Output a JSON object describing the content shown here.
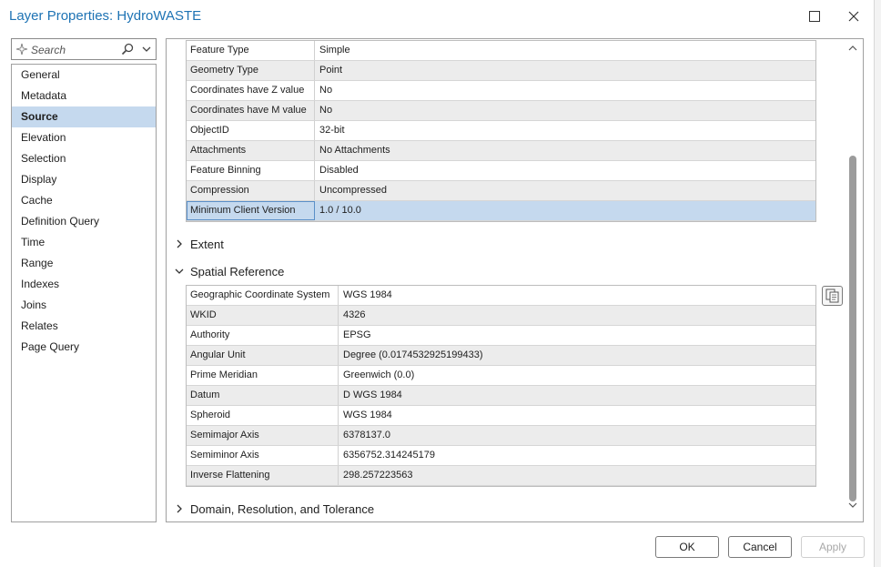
{
  "window": {
    "title": "Layer Properties: HydroWASTE"
  },
  "search": {
    "placeholder": "Search"
  },
  "nav": {
    "items": [
      "General",
      "Metadata",
      "Source",
      "Elevation",
      "Selection",
      "Display",
      "Cache",
      "Definition Query",
      "Time",
      "Range",
      "Indexes",
      "Joins",
      "Relates",
      "Page Query"
    ],
    "selected": "Source"
  },
  "source_table": {
    "rows": [
      {
        "key": "Feature Type",
        "value": "Simple"
      },
      {
        "key": "Geometry Type",
        "value": "Point"
      },
      {
        "key": "Coordinates have Z value",
        "value": "No"
      },
      {
        "key": "Coordinates have M value",
        "value": "No"
      },
      {
        "key": "ObjectID",
        "value": "32-bit"
      },
      {
        "key": "Attachments",
        "value": "No Attachments"
      },
      {
        "key": "Feature Binning",
        "value": "Disabled"
      },
      {
        "key": "Compression",
        "value": "Uncompressed"
      },
      {
        "key": "Minimum Client Version",
        "value": "1.0 / 10.0"
      }
    ],
    "selected_row": "Minimum Client Version"
  },
  "sections": {
    "extent": "Extent",
    "spatial_reference": "Spatial Reference",
    "domain": "Domain, Resolution, and Tolerance"
  },
  "spatial_table": {
    "rows": [
      {
        "key": "Geographic Coordinate System",
        "value": "WGS 1984"
      },
      {
        "key": "WKID",
        "value": "4326"
      },
      {
        "key": "Authority",
        "value": "EPSG"
      },
      {
        "key": "Angular Unit",
        "value": "Degree (0.0174532925199433)"
      },
      {
        "key": "Prime Meridian",
        "value": "Greenwich (0.0)"
      },
      {
        "key": "Datum",
        "value": "D WGS 1984"
      },
      {
        "key": "Spheroid",
        "value": "WGS 1984"
      },
      {
        "key": "Semimajor Axis",
        "value": "6378137.0"
      },
      {
        "key": "Semiminor Axis",
        "value": "6356752.314245179"
      },
      {
        "key": "Inverse Flattening",
        "value": "298.257223563"
      }
    ]
  },
  "buttons": {
    "ok": "OK",
    "cancel": "Cancel",
    "apply": "Apply"
  },
  "colors": {
    "title": "#1e73b4",
    "selection": "#c5d9ee"
  }
}
